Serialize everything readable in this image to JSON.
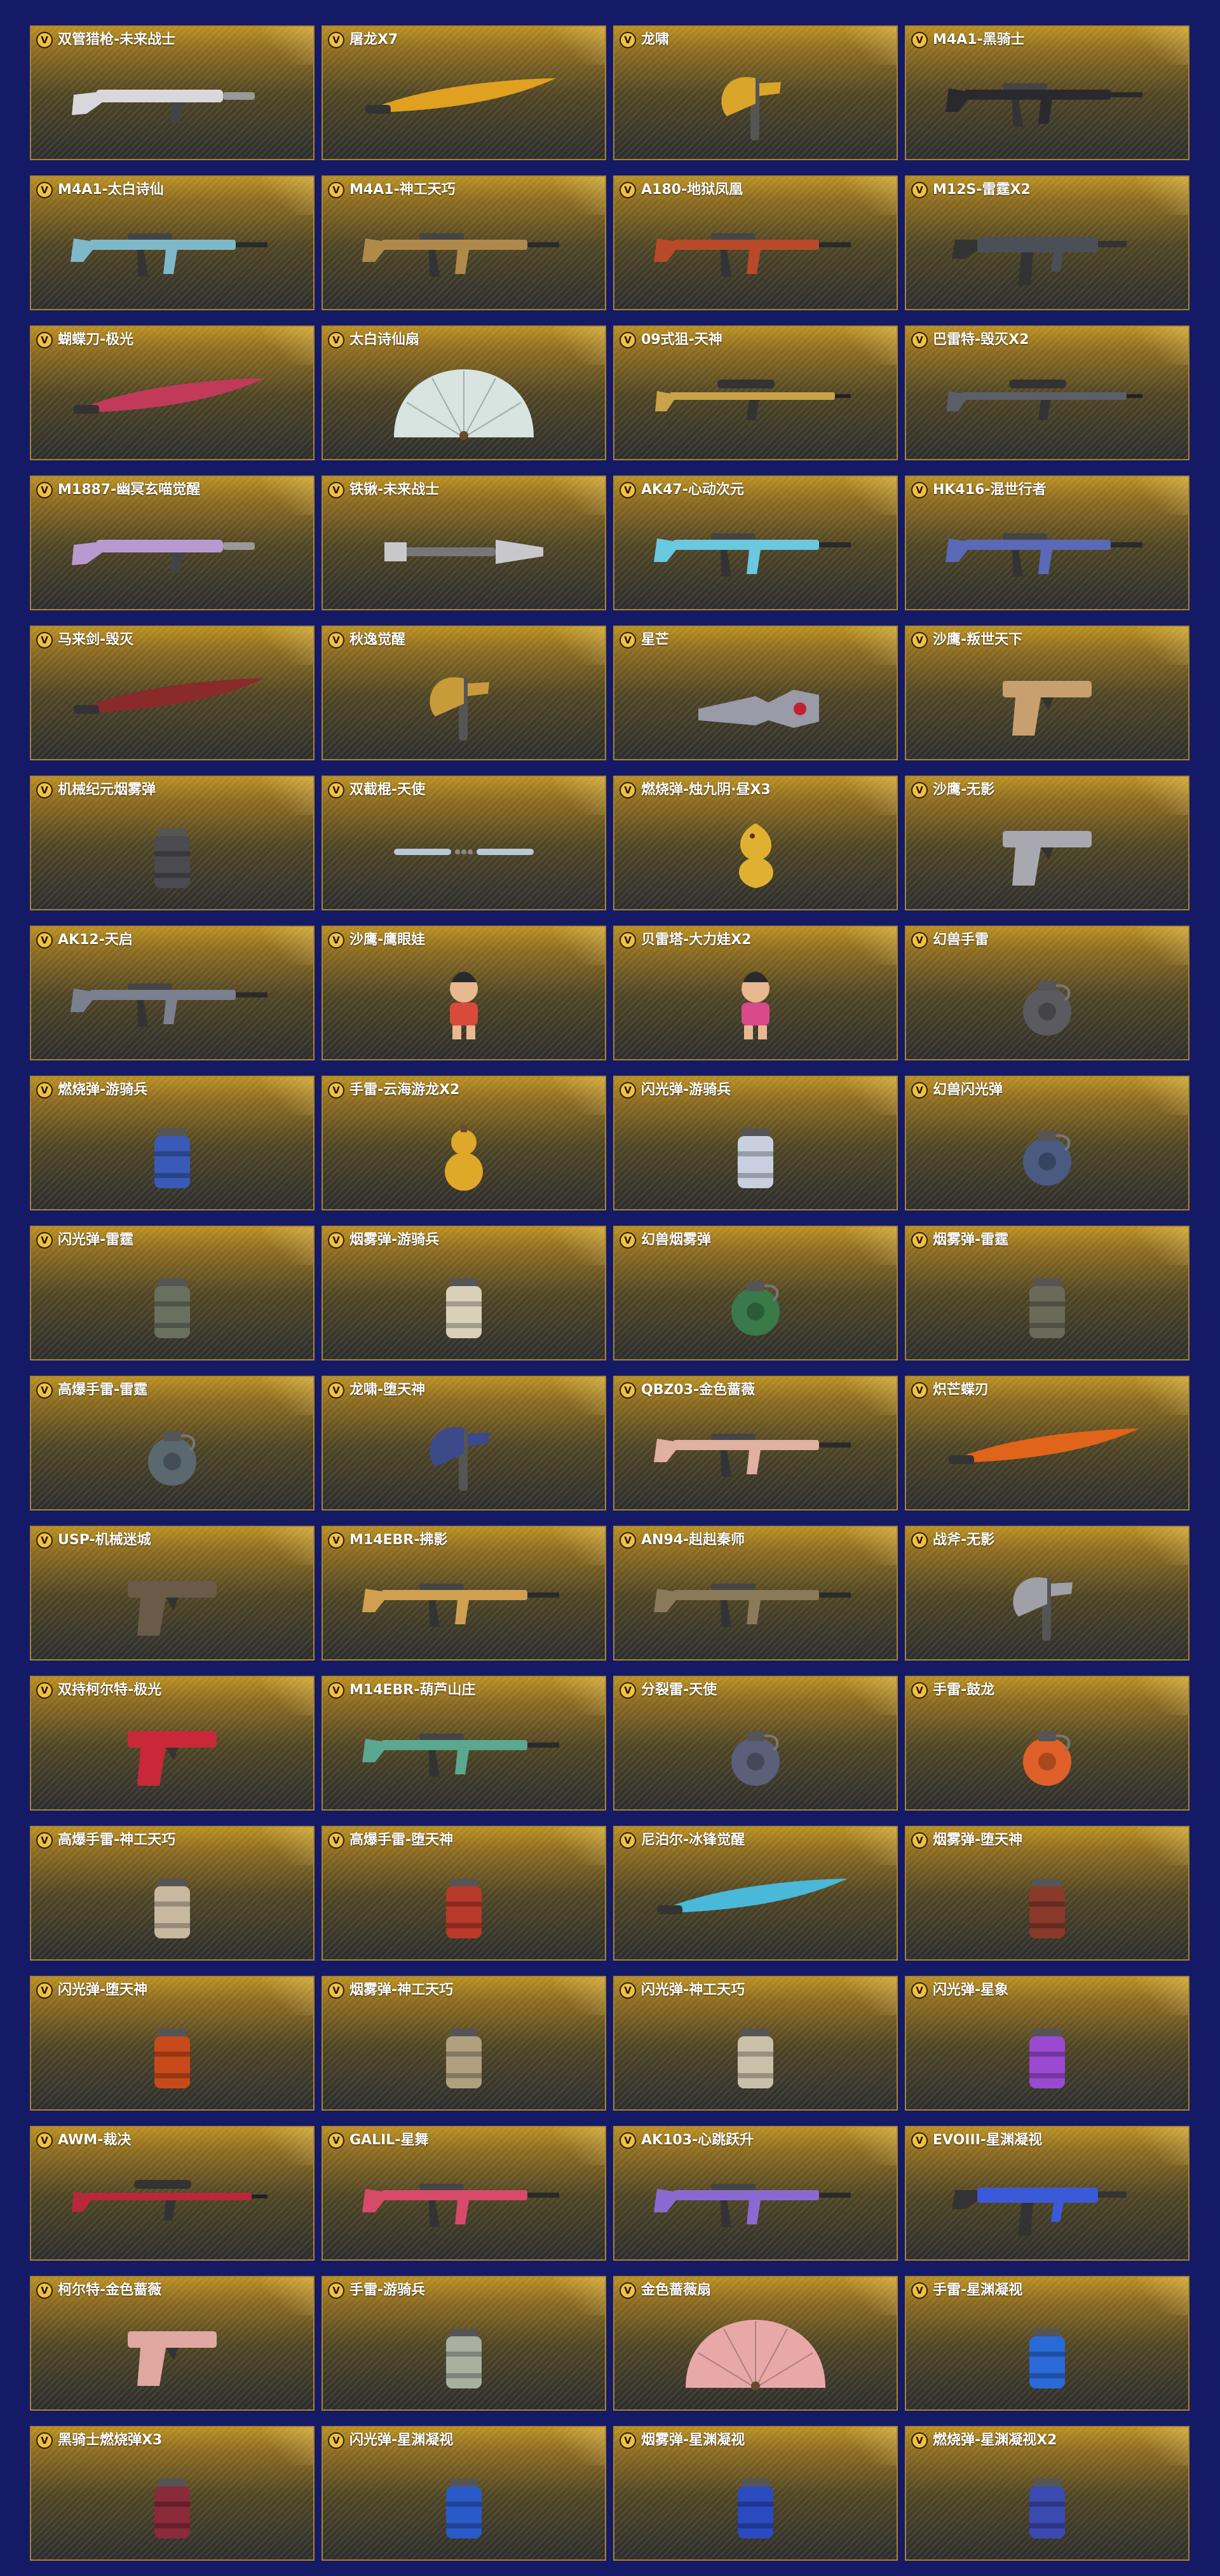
{
  "badge_letter": "V",
  "colors": {
    "page_background": "#151a66",
    "card_border": "#a8842a",
    "badge": "#f2c040"
  },
  "items": [
    {
      "name": "双管猎枪-未来战士",
      "icon": "shotgun-icon",
      "color": "#d8d8dc"
    },
    {
      "name": "屠龙X7",
      "icon": "blade-icon",
      "color": "#e0a020"
    },
    {
      "name": "龙啸",
      "icon": "axe-icon",
      "color": "#d9a52a"
    },
    {
      "name": "M4A1-黑骑士",
      "icon": "rifle-icon",
      "color": "#2a2a2e"
    },
    {
      "name": "M4A1-太白诗仙",
      "icon": "rifle-icon",
      "color": "#7fb8c8"
    },
    {
      "name": "M4A1-神工天巧",
      "icon": "rifle-icon",
      "color": "#b08a4a"
    },
    {
      "name": "A180-地狱凤凰",
      "icon": "rifle-icon",
      "color": "#b84a2a"
    },
    {
      "name": "M12S-雷霆X2",
      "icon": "smg-icon",
      "color": "#4a4f58"
    },
    {
      "name": "蝴蝶刀-极光",
      "icon": "blade-icon",
      "color": "#c23a5a"
    },
    {
      "name": "太白诗仙扇",
      "icon": "fan-icon",
      "color": "#d8e4e0"
    },
    {
      "name": "09式狙-天神",
      "icon": "sniper-icon",
      "color": "#c9a24a"
    },
    {
      "name": "巴雷特-毁灭X2",
      "icon": "sniper-icon",
      "color": "#5a5f6a"
    },
    {
      "name": "M1887-幽冥玄喵觉醒",
      "icon": "shotgun-icon",
      "color": "#b89ad0"
    },
    {
      "name": "铁锹-未来战士",
      "icon": "shovel-icon",
      "color": "#c8c8cc"
    },
    {
      "name": "AK47-心动次元",
      "icon": "rifle-icon",
      "color": "#6ac8e0"
    },
    {
      "name": "HK416-混世行者",
      "icon": "rifle-icon",
      "color": "#5a6ab8"
    },
    {
      "name": "马来剑-毁灭",
      "icon": "blade-icon",
      "color": "#8a2a2a"
    },
    {
      "name": "秋逸觉醒",
      "icon": "axe-icon",
      "color": "#c89a3a"
    },
    {
      "name": "星芒",
      "icon": "gauntlet-icon",
      "color": "#9a9aa8"
    },
    {
      "name": "沙鹰-叛世天下",
      "icon": "pistol-icon",
      "color": "#c8a070"
    },
    {
      "name": "机械纪元烟雾弹",
      "icon": "canister-icon",
      "color": "#4a4a50"
    },
    {
      "name": "双截棍-天使",
      "icon": "nunchaku-icon",
      "color": "#b8c8d8"
    },
    {
      "name": "燃烧弹-烛九阴·昼X3",
      "icon": "dragon-figure-icon",
      "color": "#e0b030"
    },
    {
      "name": "沙鹰-无影",
      "icon": "pistol-icon",
      "color": "#a8a8b0"
    },
    {
      "name": "AK12-天启",
      "icon": "rifle-icon",
      "color": "#7a8090"
    },
    {
      "name": "沙鹰-鹰眼娃",
      "icon": "figure-icon",
      "color": "#d84a3a"
    },
    {
      "name": "贝雷塔-大力娃X2",
      "icon": "figure-icon",
      "color": "#d84a8a"
    },
    {
      "name": "幻兽手雷",
      "icon": "grenade-icon",
      "color": "#5a5a60"
    },
    {
      "name": "燃烧弹-游骑兵",
      "icon": "canister-icon",
      "color": "#3a5ab8"
    },
    {
      "name": "手雷-云海游龙X2",
      "icon": "gourd-icon",
      "color": "#e0a828"
    },
    {
      "name": "闪光弹-游骑兵",
      "icon": "canister-icon",
      "color": "#c8d0e0"
    },
    {
      "name": "幻兽闪光弹",
      "icon": "grenade-icon",
      "color": "#4a5a80"
    },
    {
      "name": "闪光弹-雷霆",
      "icon": "canister-icon",
      "color": "#6a7060"
    },
    {
      "name": "烟雾弹-游骑兵",
      "icon": "canister-icon",
      "color": "#d8d0b8"
    },
    {
      "name": "幻兽烟雾弹",
      "icon": "grenade-icon",
      "color": "#3a7a4a"
    },
    {
      "name": "烟雾弹-雷霆",
      "icon": "canister-icon",
      "color": "#6a6a58"
    },
    {
      "name": "高爆手雷-雷霆",
      "icon": "grenade-icon",
      "color": "#5a6870"
    },
    {
      "name": "龙啸-堕天神",
      "icon": "axe-icon",
      "color": "#3a4a8a"
    },
    {
      "name": "QBZ03-金色蔷薇",
      "icon": "rifle-icon",
      "color": "#e0b0a0"
    },
    {
      "name": "炽芒蝶刃",
      "icon": "blade-icon",
      "color": "#e0641a"
    },
    {
      "name": "USP-机械迷城",
      "icon": "pistol-icon",
      "color": "#6a5a48"
    },
    {
      "name": "M14EBR-拂影",
      "icon": "rifle-icon",
      "color": "#d0a050"
    },
    {
      "name": "AN94-赳赳秦师",
      "icon": "rifle-icon",
      "color": "#8a7a5a"
    },
    {
      "name": "战斧-无影",
      "icon": "axe-icon",
      "color": "#a0a0a8"
    },
    {
      "name": "双持柯尔特-极光",
      "icon": "pistol-icon",
      "color": "#c8283a"
    },
    {
      "name": "M14EBR-葫芦山庄",
      "icon": "rifle-icon",
      "color": "#5aa890"
    },
    {
      "name": "分裂雷-天使",
      "icon": "grenade-icon",
      "color": "#5a6078"
    },
    {
      "name": "手雷-鼓龙",
      "icon": "grenade-icon",
      "color": "#e0602a"
    },
    {
      "name": "高爆手雷-神工天巧",
      "icon": "canister-icon",
      "color": "#c8b8a0"
    },
    {
      "name": "高爆手雷-堕天神",
      "icon": "canister-icon",
      "color": "#b83a2a"
    },
    {
      "name": "尼泊尔-冰锋觉醒",
      "icon": "blade-icon",
      "color": "#4ab8d8"
    },
    {
      "name": "烟雾弹-堕天神",
      "icon": "canister-icon",
      "color": "#8a3a2a"
    },
    {
      "name": "闪光弹-堕天神",
      "icon": "canister-icon",
      "color": "#c84a1a"
    },
    {
      "name": "烟雾弹-神工天巧",
      "icon": "canister-icon",
      "color": "#b0a080"
    },
    {
      "name": "闪光弹-神工天巧",
      "icon": "canister-icon",
      "color": "#c8c0a8"
    },
    {
      "name": "闪光弹-星象",
      "icon": "canister-icon",
      "color": "#9a4ad0"
    },
    {
      "name": "AWM-裁决",
      "icon": "sniper-icon",
      "color": "#b8283a"
    },
    {
      "name": "GALIL-星舞",
      "icon": "rifle-icon",
      "color": "#d84a6a"
    },
    {
      "name": "AK103-心跳跃升",
      "icon": "rifle-icon",
      "color": "#8a6ad0"
    },
    {
      "name": "EVOIII-星渊凝视",
      "icon": "smg-icon",
      "color": "#3a5ad8"
    },
    {
      "name": "柯尔特-金色蔷薇",
      "icon": "pistol-icon",
      "color": "#e0a8a0"
    },
    {
      "name": "手雷-游骑兵",
      "icon": "canister-icon",
      "color": "#a8b0a0"
    },
    {
      "name": "金色蔷薇扇",
      "icon": "fan-icon",
      "color": "#e8a8a8"
    },
    {
      "name": "手雷-星渊凝视",
      "icon": "canister-icon",
      "color": "#2a6ad8"
    },
    {
      "name": "黑骑士燃烧弹X3",
      "icon": "canister-icon",
      "color": "#8a2a3a"
    },
    {
      "name": "闪光弹-星渊凝视",
      "icon": "canister-icon",
      "color": "#2a5ac8"
    },
    {
      "name": "烟雾弹-星渊凝视",
      "icon": "canister-icon",
      "color": "#2a4ac0"
    },
    {
      "name": "燃烧弹-星渊凝视X2",
      "icon": "canister-icon",
      "color": "#3a4ab0"
    }
  ]
}
